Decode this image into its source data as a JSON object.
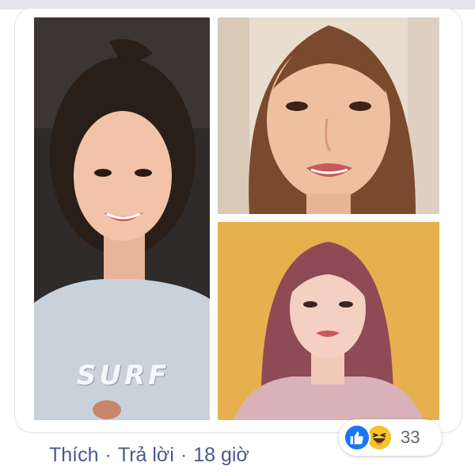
{
  "comment": {
    "images": [
      {
        "alt": "photo-1"
      },
      {
        "alt": "photo-2"
      },
      {
        "alt": "photo-3"
      }
    ],
    "shirt_text": "SURF",
    "actions": {
      "like_label": "Thích",
      "reply_label": "Trả lời",
      "separator": "·",
      "time": "18 giờ"
    },
    "reactions": {
      "icons": [
        "like-icon",
        "haha-icon"
      ],
      "count": "33"
    }
  },
  "colors": {
    "link": "#4b5a8c",
    "like_blue": "#1877f2",
    "haha_yellow": "#f7c328",
    "photo3_background": "#e7b04e"
  }
}
